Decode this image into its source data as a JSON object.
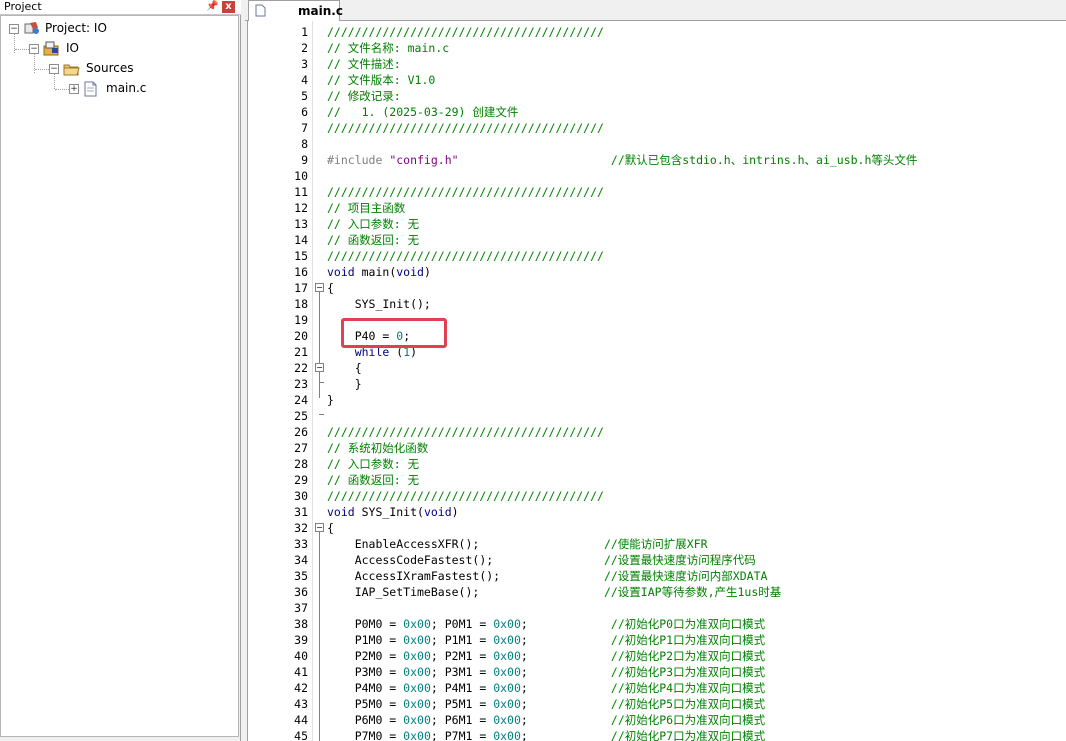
{
  "project_panel": {
    "title": "Project",
    "pin_glyph": "ᅟ",
    "close_glyph": "x",
    "tree": {
      "root": "Project: IO",
      "target": "IO",
      "group": "Sources",
      "file": "main.c"
    }
  },
  "editor": {
    "tab_label": "main.c",
    "lines": [
      {
        "n": "1",
        "parts": [
          [
            "comment",
            "////////////////////////////////////////"
          ]
        ]
      },
      {
        "n": "2",
        "parts": [
          [
            "comment",
            "// 文件名称: main.c"
          ]
        ]
      },
      {
        "n": "3",
        "parts": [
          [
            "comment",
            "// 文件描述:"
          ]
        ]
      },
      {
        "n": "4",
        "parts": [
          [
            "comment",
            "// 文件版本: V1.0"
          ]
        ]
      },
      {
        "n": "5",
        "parts": [
          [
            "comment",
            "// 修改记录:"
          ]
        ]
      },
      {
        "n": "6",
        "parts": [
          [
            "comment",
            "//   1. (2025-03-29) 创建文件"
          ]
        ]
      },
      {
        "n": "7",
        "parts": [
          [
            "comment",
            "////////////////////////////////////////"
          ]
        ]
      },
      {
        "n": "8",
        "parts": []
      },
      {
        "n": "9",
        "parts": [
          [
            "pp",
            "#include "
          ],
          [
            "str",
            "\"config.h\""
          ],
          [
            "plain",
            "                      "
          ],
          [
            "comment",
            "//默认已包含stdio.h、intrins.h、ai_usb.h等头文件"
          ]
        ]
      },
      {
        "n": "10",
        "parts": []
      },
      {
        "n": "11",
        "parts": [
          [
            "comment",
            "////////////////////////////////////////"
          ]
        ]
      },
      {
        "n": "12",
        "parts": [
          [
            "comment",
            "// 项目主函数"
          ]
        ]
      },
      {
        "n": "13",
        "parts": [
          [
            "comment",
            "// 入口参数: 无"
          ]
        ]
      },
      {
        "n": "14",
        "parts": [
          [
            "comment",
            "// 函数返回: 无"
          ]
        ]
      },
      {
        "n": "15",
        "parts": [
          [
            "comment",
            "////////////////////////////////////////"
          ]
        ]
      },
      {
        "n": "16",
        "parts": [
          [
            "kw",
            "void"
          ],
          [
            "plain",
            " main("
          ],
          [
            "kw",
            "void"
          ],
          [
            "plain",
            ")"
          ]
        ]
      },
      {
        "n": "17",
        "parts": [
          [
            "plain",
            "{"
          ]
        ]
      },
      {
        "n": "18",
        "parts": [
          [
            "plain",
            "    SYS_Init();"
          ]
        ]
      },
      {
        "n": "19",
        "parts": []
      },
      {
        "n": "20",
        "parts": [
          [
            "plain",
            "    P40 = "
          ],
          [
            "num",
            "0"
          ],
          [
            "plain",
            ";"
          ]
        ]
      },
      {
        "n": "21",
        "parts": [
          [
            "plain",
            "    "
          ],
          [
            "kw",
            "while"
          ],
          [
            "plain",
            " ("
          ],
          [
            "num",
            "1"
          ],
          [
            "plain",
            ")"
          ]
        ]
      },
      {
        "n": "22",
        "parts": [
          [
            "plain",
            "    {"
          ]
        ]
      },
      {
        "n": "23",
        "parts": [
          [
            "plain",
            "    }"
          ]
        ]
      },
      {
        "n": "24",
        "parts": [
          [
            "plain",
            "}"
          ]
        ]
      },
      {
        "n": "25",
        "parts": []
      },
      {
        "n": "26",
        "parts": [
          [
            "comment",
            "////////////////////////////////////////"
          ]
        ]
      },
      {
        "n": "27",
        "parts": [
          [
            "comment",
            "// 系统初始化函数"
          ]
        ]
      },
      {
        "n": "28",
        "parts": [
          [
            "comment",
            "// 入口参数: 无"
          ]
        ]
      },
      {
        "n": "29",
        "parts": [
          [
            "comment",
            "// 函数返回: 无"
          ]
        ]
      },
      {
        "n": "30",
        "parts": [
          [
            "comment",
            "////////////////////////////////////////"
          ]
        ]
      },
      {
        "n": "31",
        "parts": [
          [
            "kw",
            "void"
          ],
          [
            "plain",
            " SYS_Init("
          ],
          [
            "kw",
            "void"
          ],
          [
            "plain",
            ")"
          ]
        ]
      },
      {
        "n": "32",
        "parts": [
          [
            "plain",
            "{"
          ]
        ]
      },
      {
        "n": "33",
        "parts": [
          [
            "plain",
            "    EnableAccessXFR();                  "
          ],
          [
            "comment",
            "//使能访问扩展XFR"
          ]
        ]
      },
      {
        "n": "34",
        "parts": [
          [
            "plain",
            "    AccessCodeFastest();                "
          ],
          [
            "comment",
            "//设置最快速度访问程序代码"
          ]
        ]
      },
      {
        "n": "35",
        "parts": [
          [
            "plain",
            "    AccessIXramFastest();               "
          ],
          [
            "comment",
            "//设置最快速度访问内部XDATA"
          ]
        ]
      },
      {
        "n": "36",
        "parts": [
          [
            "plain",
            "    IAP_SetTimeBase();                  "
          ],
          [
            "comment",
            "//设置IAP等待参数,产生1us时基"
          ]
        ]
      },
      {
        "n": "37",
        "parts": []
      },
      {
        "n": "38",
        "parts": [
          [
            "plain",
            "    P0M0 = "
          ],
          [
            "num",
            "0x00"
          ],
          [
            "plain",
            "; P0M1 = "
          ],
          [
            "num",
            "0x00"
          ],
          [
            "plain",
            ";            "
          ],
          [
            "comment",
            "//初始化P0口为准双向口模式"
          ]
        ]
      },
      {
        "n": "39",
        "parts": [
          [
            "plain",
            "    P1M0 = "
          ],
          [
            "num",
            "0x00"
          ],
          [
            "plain",
            "; P1M1 = "
          ],
          [
            "num",
            "0x00"
          ],
          [
            "plain",
            ";            "
          ],
          [
            "comment",
            "//初始化P1口为准双向口模式"
          ]
        ]
      },
      {
        "n": "40",
        "parts": [
          [
            "plain",
            "    P2M0 = "
          ],
          [
            "num",
            "0x00"
          ],
          [
            "plain",
            "; P2M1 = "
          ],
          [
            "num",
            "0x00"
          ],
          [
            "plain",
            ";            "
          ],
          [
            "comment",
            "//初始化P2口为准双向口模式"
          ]
        ]
      },
      {
        "n": "41",
        "parts": [
          [
            "plain",
            "    P3M0 = "
          ],
          [
            "num",
            "0x00"
          ],
          [
            "plain",
            "; P3M1 = "
          ],
          [
            "num",
            "0x00"
          ],
          [
            "plain",
            ";            "
          ],
          [
            "comment",
            "//初始化P3口为准双向口模式"
          ]
        ]
      },
      {
        "n": "42",
        "parts": [
          [
            "plain",
            "    P4M0 = "
          ],
          [
            "num",
            "0x00"
          ],
          [
            "plain",
            "; P4M1 = "
          ],
          [
            "num",
            "0x00"
          ],
          [
            "plain",
            ";            "
          ],
          [
            "comment",
            "//初始化P4口为准双向口模式"
          ]
        ]
      },
      {
        "n": "43",
        "parts": [
          [
            "plain",
            "    P5M0 = "
          ],
          [
            "num",
            "0x00"
          ],
          [
            "plain",
            "; P5M1 = "
          ],
          [
            "num",
            "0x00"
          ],
          [
            "plain",
            ";            "
          ],
          [
            "comment",
            "//初始化P5口为准双向口模式"
          ]
        ]
      },
      {
        "n": "44",
        "parts": [
          [
            "plain",
            "    P6M0 = "
          ],
          [
            "num",
            "0x00"
          ],
          [
            "plain",
            "; P6M1 = "
          ],
          [
            "num",
            "0x00"
          ],
          [
            "plain",
            ";            "
          ],
          [
            "comment",
            "//初始化P6口为准双向口模式"
          ]
        ]
      },
      {
        "n": "45",
        "parts": [
          [
            "plain",
            "    P7M0 = "
          ],
          [
            "num",
            "0x00"
          ],
          [
            "plain",
            "; P7M1 = "
          ],
          [
            "num",
            "0x00"
          ],
          [
            "plain",
            ";            "
          ],
          [
            "comment",
            "//初始化P7口为准双向口模式"
          ]
        ]
      }
    ]
  },
  "colors": {
    "comment": "#008000",
    "keyword": "#00007f",
    "preprocessor": "#7f7f7f",
    "string": "#7f007f",
    "number": "#007f7f",
    "highlight_box": "#e04050"
  }
}
